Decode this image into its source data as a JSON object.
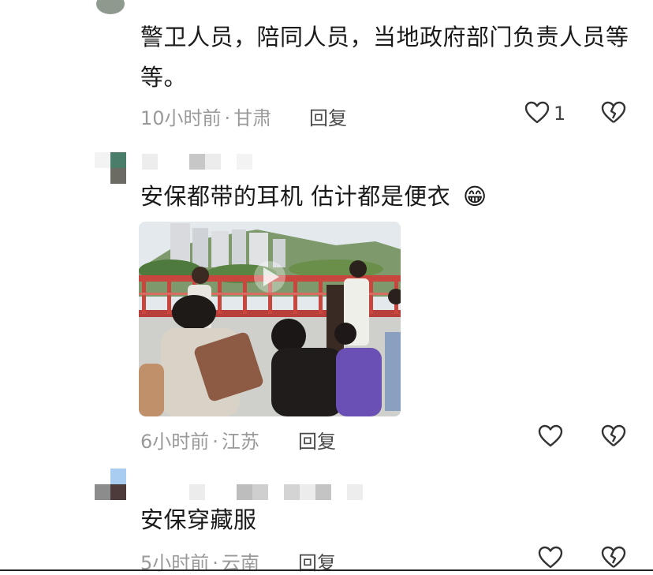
{
  "comments": [
    {
      "text_line1": "警卫人员，陪同人员，当地政府部门负责人员等",
      "text_line2": "等。",
      "time": "10小时前",
      "location": "甘肃",
      "reply_label": "回复",
      "like_count": "1"
    },
    {
      "text": "安保都带的耳机 估计都是便衣",
      "emoji": "😁",
      "time": "6小时前",
      "location": "江苏",
      "reply_label": "回复",
      "has_video": true
    },
    {
      "text": "安保穿藏服",
      "time": "5小时前",
      "location": "云南",
      "reply_label": "回复"
    }
  ],
  "separator": "·",
  "colors": {
    "meta_gray": "#9a9a9a",
    "bridge_red": "#c9463f",
    "sky": "#e6ecf0"
  },
  "icons": {
    "like": "heart-outline-icon",
    "dislike": "broken-heart-icon",
    "play": "play-icon"
  }
}
